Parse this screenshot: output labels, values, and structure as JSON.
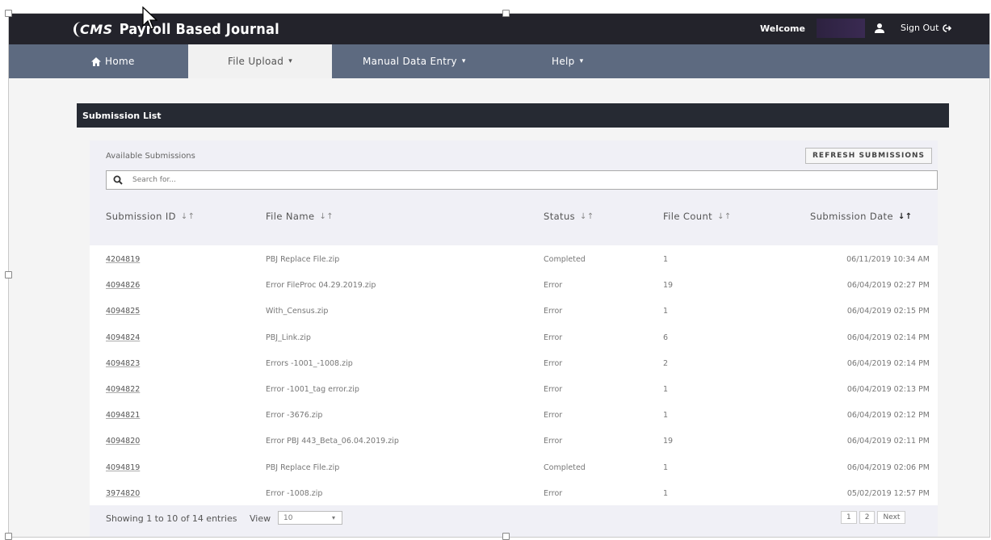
{
  "header": {
    "logo_cms": "CMS",
    "logo_title": "Payroll Based Journal",
    "welcome": "Welcome",
    "sign_out": "Sign Out"
  },
  "nav": {
    "items": [
      {
        "label": "Home",
        "icon": "home-icon"
      },
      {
        "label": "File Upload",
        "active": true
      },
      {
        "label": "Manual Data Entry"
      },
      {
        "label": "Help"
      }
    ]
  },
  "panel": {
    "title": "Submission List",
    "available": "Available Submissions",
    "refresh": "REFRESH SUBMISSIONS",
    "search_placeholder": "Search for..."
  },
  "table": {
    "columns": [
      "Submission ID",
      "File Name",
      "Status",
      "File Count",
      "Submission Date"
    ],
    "rows": [
      [
        "4204819",
        "PBJ Replace File.zip",
        "Completed",
        "1",
        "06/11/2019 10:34 AM"
      ],
      [
        "4094826",
        "Error FileProc 04.29.2019.zip",
        "Error",
        "19",
        "06/04/2019 02:27 PM"
      ],
      [
        "4094825",
        "With_Census.zip",
        "Error",
        "1",
        "06/04/2019 02:15 PM"
      ],
      [
        "4094824",
        "PBJ_Link.zip",
        "Error",
        "6",
        "06/04/2019 02:14 PM"
      ],
      [
        "4094823",
        "Errors -1001_-1008.zip",
        "Error",
        "2",
        "06/04/2019 02:14 PM"
      ],
      [
        "4094822",
        "Error -1001_tag error.zip",
        "Error",
        "1",
        "06/04/2019 02:13 PM"
      ],
      [
        "4094821",
        "Error -3676.zip",
        "Error",
        "1",
        "06/04/2019 02:12 PM"
      ],
      [
        "4094820",
        "Error PBJ 443_Beta_06.04.2019.zip",
        "Error",
        "19",
        "06/04/2019 02:11 PM"
      ],
      [
        "4094819",
        "PBJ Replace File.zip",
        "Completed",
        "1",
        "06/04/2019 02:06 PM"
      ],
      [
        "3974820",
        "Error -1008.zip",
        "Error",
        "1",
        "05/02/2019 12:57 PM"
      ]
    ]
  },
  "footer": {
    "showing": "Showing 1 to 10 of 14 entries",
    "view_label": "View",
    "view_value": "10",
    "pages": [
      "1",
      "2",
      "Next"
    ]
  },
  "colors": {
    "topbar": "#23232b",
    "nav": "#5d6a80",
    "panel_head": "#262a33"
  }
}
